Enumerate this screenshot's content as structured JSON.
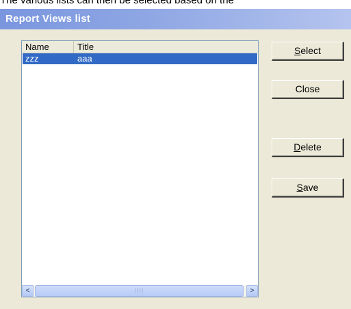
{
  "background": {
    "text": "The various lists can then be selected based on the"
  },
  "dialog": {
    "title": "Report Views list"
  },
  "listview": {
    "columns": [
      "Name",
      "Title"
    ],
    "rows": [
      {
        "name": "zzz",
        "title": "aaa",
        "selected": true
      }
    ],
    "scrollbar": {
      "left_arrow": "<",
      "right_arrow": ">",
      "thumb_grip": "IIII"
    }
  },
  "buttons": {
    "select": {
      "mnemonic": "S",
      "rest": "elect"
    },
    "close": {
      "label": "Close"
    },
    "delete": {
      "mnemonic": "D",
      "rest": "elete"
    },
    "save": {
      "mnemonic": "S",
      "rest": "ave"
    }
  },
  "colors": {
    "titlebar_start": "#7a96df",
    "titlebar_end": "#b5c4ef",
    "dialog_bg": "#ece9d8",
    "selection": "#316ac5"
  }
}
